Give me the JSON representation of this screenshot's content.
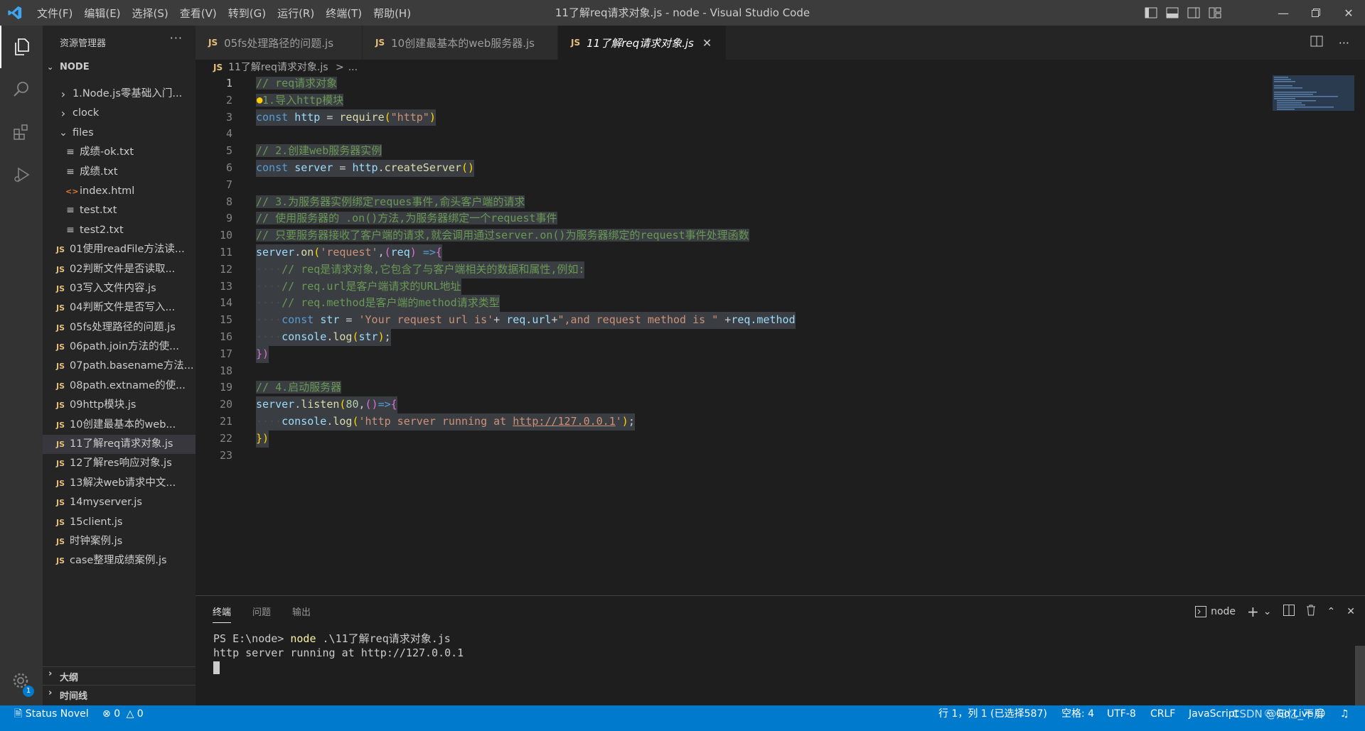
{
  "window": {
    "title": "11了解req请求对象.js - node - Visual Studio Code",
    "menu": [
      "文件(F)",
      "编辑(E)",
      "选择(S)",
      "查看(V)",
      "转到(G)",
      "运行(R)",
      "终端(T)",
      "帮助(H)"
    ]
  },
  "sidebar": {
    "header": "资源管理器",
    "root": "NODE",
    "items": [
      {
        "label": "1.Node.js零基础入门...",
        "kind": "folder-collapsed"
      },
      {
        "label": "clock",
        "kind": "folder-collapsed"
      },
      {
        "label": "files",
        "kind": "folder-open"
      },
      {
        "label": "成绩-ok.txt",
        "kind": "txt"
      },
      {
        "label": "成绩.txt",
        "kind": "txt"
      },
      {
        "label": "index.html",
        "kind": "html"
      },
      {
        "label": "test.txt",
        "kind": "txt"
      },
      {
        "label": "test2.txt",
        "kind": "txt"
      },
      {
        "label": "01使用readFile方法读...",
        "kind": "js"
      },
      {
        "label": "02判断文件是否读取...",
        "kind": "js"
      },
      {
        "label": "03写入文件内容.js",
        "kind": "js"
      },
      {
        "label": "04判断文件是否写入...",
        "kind": "js"
      },
      {
        "label": "05fs处理路径的问题.js",
        "kind": "js"
      },
      {
        "label": "06path.join方法的使...",
        "kind": "js"
      },
      {
        "label": "07path.basename方法...",
        "kind": "js"
      },
      {
        "label": "08path.extname的使...",
        "kind": "js"
      },
      {
        "label": "09http模块.js",
        "kind": "js"
      },
      {
        "label": "10创建最基本的web...",
        "kind": "js"
      },
      {
        "label": "11了解req请求对象.js",
        "kind": "js"
      },
      {
        "label": "12了解res响应对象.js",
        "kind": "js"
      },
      {
        "label": "13解决web请求中文...",
        "kind": "js"
      },
      {
        "label": "14myserver.js",
        "kind": "js"
      },
      {
        "label": "15client.js",
        "kind": "js"
      },
      {
        "label": "时钟案例.js",
        "kind": "js"
      },
      {
        "label": "case整理成绩案例.js",
        "kind": "js"
      }
    ],
    "outline": "大纲",
    "timeline": "时间线"
  },
  "tabs": [
    {
      "label": "05fs处理路径的问题.js"
    },
    {
      "label": "10创建最基本的web服务器.js"
    },
    {
      "label": "11了解req请求对象.js"
    }
  ],
  "breadcrumb": {
    "file": "11了解req请求对象.js",
    "sep": ">",
    "rest": "..."
  },
  "badges": {
    "js": "JS",
    "settings_count": "1"
  },
  "editor": {
    "line_numbers": [
      "1",
      "2",
      "3",
      "4",
      "5",
      "6",
      "7",
      "8",
      "9",
      "10",
      "11",
      "12",
      "13",
      "14",
      "15",
      "16",
      "17",
      "18",
      "19",
      "20",
      "21",
      "22",
      "23"
    ],
    "code": {
      "l1": "// req请求对象",
      "l2": " 1.导入http模块",
      "l3_kw": "const",
      "l3_var": "http",
      "l3_eq": " = ",
      "l3_fn": "require",
      "l3_str": "\"http\"",
      "l5": "// 2.创建web服务器实例",
      "l6_kw": "const",
      "l6_var": "server",
      "l6_eq": " = ",
      "l6_obj": "http",
      "l6_fn": "createServer",
      "l8": "// 3.为服务器实例绑定reques事件,俞头客户端的请求",
      "l9": "// 使用服务器的 .on()方法,为服务器绑定一个request事件",
      "l10": "// 只要服务器接收了客户端的请求,就会调用通过server.on()为服务器绑定的request事件处理函数",
      "l11_obj": "server",
      "l11_fn": "on",
      "l11_str": "'request'",
      "l11_param": "req",
      "l11_arrow": "=>",
      "l12": "// req是请求对象,它包含了与客户端相关的数据和属性,例如:",
      "l13": "// req.url是客户端请求的URL地址",
      "l14": "// req.method是客户端的method请求类型",
      "l15_kw": "const",
      "l15_var": "str",
      "l15_eq": " = ",
      "l15_str1": "'Your request url is'",
      "l15_plus1": "+ ",
      "l15_v1": "req.url",
      "l15_plus2": "+",
      "l15_str2": "\",and request method is \"",
      "l15_plus3": " +",
      "l15_v2": "req.method",
      "l16_obj": "console",
      "l16_fn": "log",
      "l16_var": "str",
      "l19": "// 4.启动服务器",
      "l20_obj": "server",
      "l20_fn": "listen",
      "l20_num": "80",
      "l20_arrow": "=>",
      "l21_obj": "console",
      "l21_fn": "log",
      "l21_str": "'http server running at ",
      "l21_url": "http://127.0.0.1",
      "l21_str_end": "'"
    }
  },
  "panel": {
    "tabs": [
      "终端",
      "问题",
      "输出"
    ],
    "shell": "node",
    "terminal": {
      "prompt": "PS E:\\node> ",
      "cmd": "node",
      "args": " .\\11了解req请求对象.js",
      "output": "http server running at http://127.0.0.1"
    }
  },
  "statusbar": {
    "left_novel": "Status Novel",
    "errors": "0",
    "warnings": "0",
    "cursor": "行 1，列 1 (已选择587)",
    "spaces": "空格: 4",
    "encoding": "UTF-8",
    "eol": "CRLF",
    "language": "JavaScript",
    "golive": "Go Live",
    "watermark": "CSDN @知忆_不屏"
  },
  "colors": {
    "accent": "#007acc",
    "js_badge": "#e5c07b",
    "comment": "#6a9955",
    "keyword": "#569cd6",
    "string": "#ce9178"
  }
}
